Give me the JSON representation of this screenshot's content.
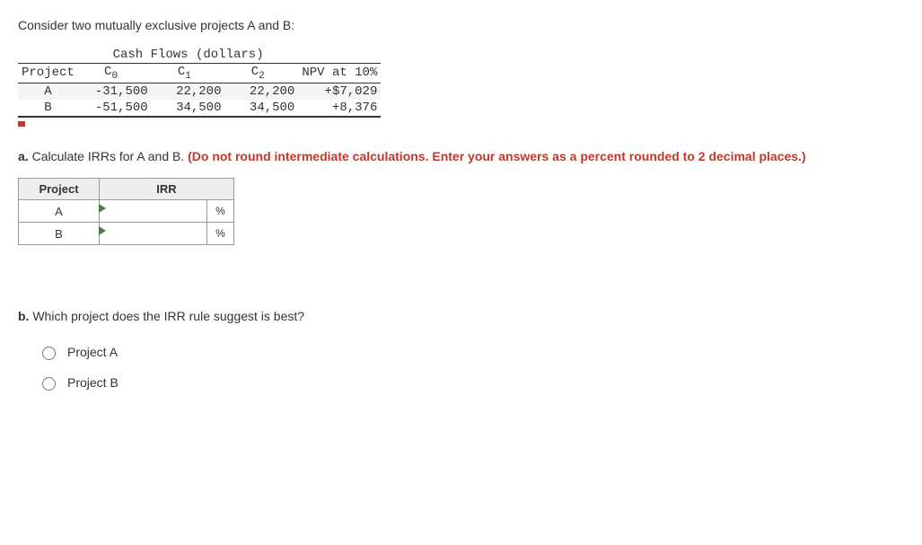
{
  "intro": "Consider two mutually exclusive projects A and B:",
  "table": {
    "group_header": "Cash Flows (dollars)",
    "headers": {
      "project": "Project",
      "c0": "C",
      "c0_sub": "0",
      "c1": "C",
      "c1_sub": "1",
      "c2": "C",
      "c2_sub": "2",
      "npv": "NPV at 10%"
    },
    "rows": [
      {
        "project": "A",
        "c0": "-31,500",
        "c1": "22,200",
        "c2": "22,200",
        "npv": "+$7,029"
      },
      {
        "project": "B",
        "c0": "-51,500",
        "c1": "34,500",
        "c2": "34,500",
        "npv": "+8,376"
      }
    ]
  },
  "part_a": {
    "prefix": "a.",
    "prompt": " Calculate IRRs for A and B. ",
    "instruction": "(Do not round intermediate calculations. Enter  your answers as a percent rounded to 2 decimal places.)",
    "header_project": "Project",
    "header_irr": "IRR",
    "unit": "%",
    "rows": [
      "A",
      "B"
    ]
  },
  "part_b": {
    "prefix": "b.",
    "prompt": " Which project does the IRR rule suggest is best?",
    "options": [
      "Project A",
      "Project B"
    ]
  }
}
